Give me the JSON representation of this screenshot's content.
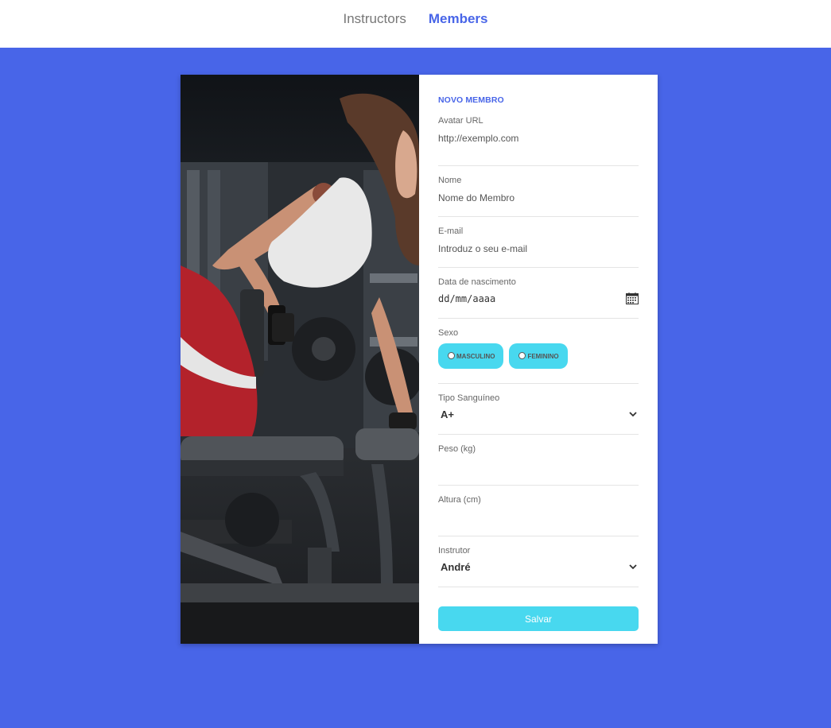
{
  "nav": {
    "items": [
      {
        "label": "Instructors",
        "active": false
      },
      {
        "label": "Members",
        "active": true
      }
    ]
  },
  "form": {
    "title": "NOVO MEMBRO",
    "avatar": {
      "label": "Avatar URL",
      "placeholder": "http://exemplo.com"
    },
    "nome": {
      "label": "Nome",
      "placeholder": "Nome do Membro"
    },
    "email": {
      "label": "E-mail",
      "placeholder": "Introduz o seu e-mail"
    },
    "nascimento": {
      "label": "Data de nascimento",
      "value": "dd/mm/aaaa",
      "icon": "calendar-icon"
    },
    "sexo": {
      "label": "Sexo",
      "options": [
        "MASCULINO",
        "FEMININO"
      ]
    },
    "sangue": {
      "label": "Tipo Sanguíneo",
      "value": "A+",
      "icon": "chevron-down-icon"
    },
    "peso": {
      "label": "Peso (kg)",
      "value": ""
    },
    "altura": {
      "label": "Altura (cm)",
      "value": ""
    },
    "instrutor": {
      "label": "Instrutor",
      "value": "André",
      "icon": "chevron-down-icon"
    },
    "save_label": "Salvar"
  },
  "colors": {
    "accent": "#4865e8",
    "button": "#48d8ef",
    "background": "#4865e8"
  },
  "photo": {
    "description_icon": "gym-photo"
  }
}
